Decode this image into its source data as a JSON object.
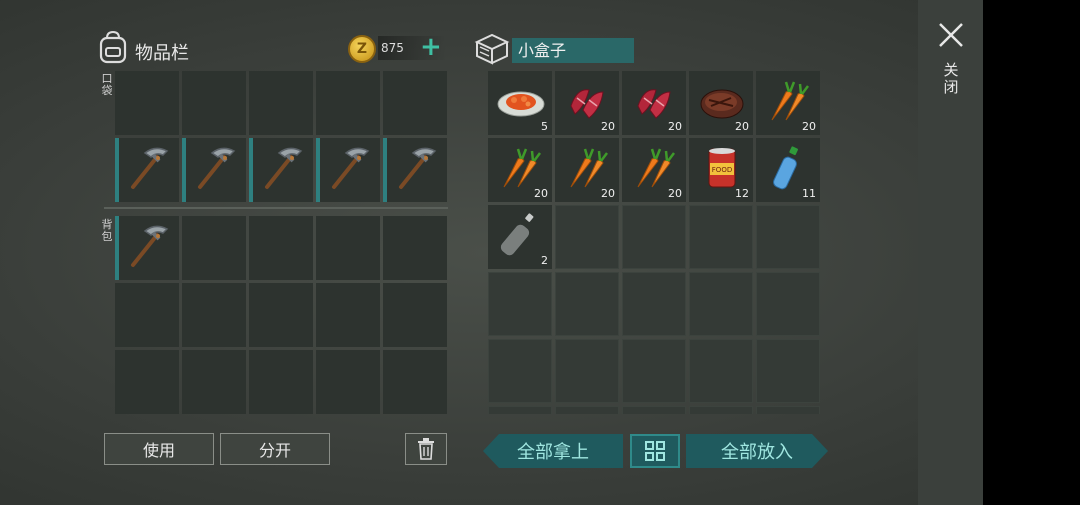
{
  "inventory": {
    "title": "物品栏",
    "coins": "875",
    "plus": "+",
    "pocket_label": "口袋",
    "backpack_label": "背包",
    "use_button": "使用",
    "split_button": "分开"
  },
  "pocket_slots": [
    {
      "item": "",
      "count": ""
    },
    {
      "item": "",
      "count": ""
    },
    {
      "item": "",
      "count": ""
    },
    {
      "item": "",
      "count": ""
    },
    {
      "item": "",
      "count": ""
    },
    {
      "item": "pickaxe",
      "count": ""
    },
    {
      "item": "pickaxe",
      "count": ""
    },
    {
      "item": "pickaxe",
      "count": ""
    },
    {
      "item": "pickaxe",
      "count": ""
    },
    {
      "item": "pickaxe",
      "count": ""
    }
  ],
  "backpack_slots": [
    {
      "item": "pickaxe",
      "count": ""
    },
    {
      "item": "",
      "count": ""
    },
    {
      "item": "",
      "count": ""
    },
    {
      "item": "",
      "count": ""
    },
    {
      "item": "",
      "count": ""
    },
    {
      "item": "",
      "count": ""
    },
    {
      "item": "",
      "count": ""
    },
    {
      "item": "",
      "count": ""
    },
    {
      "item": "",
      "count": ""
    },
    {
      "item": "",
      "count": ""
    },
    {
      "item": "",
      "count": ""
    },
    {
      "item": "",
      "count": ""
    },
    {
      "item": "",
      "count": ""
    },
    {
      "item": "",
      "count": ""
    },
    {
      "item": "",
      "count": ""
    }
  ],
  "box": {
    "name": "小盒子",
    "take_all": "全部拿上",
    "put_all": "全部放入",
    "slots": [
      {
        "item": "salad-plate",
        "count": "5"
      },
      {
        "item": "raw-meat",
        "count": "20"
      },
      {
        "item": "raw-meat",
        "count": "20"
      },
      {
        "item": "steak",
        "count": "20"
      },
      {
        "item": "carrot",
        "count": "20"
      },
      {
        "item": "carrot",
        "count": "20"
      },
      {
        "item": "carrot",
        "count": "20"
      },
      {
        "item": "carrot",
        "count": "20"
      },
      {
        "item": "canned-food",
        "count": "12"
      },
      {
        "item": "water-bottle",
        "count": "11"
      },
      {
        "item": "empty-bottle",
        "count": "2"
      },
      {
        "item": "",
        "count": ""
      },
      {
        "item": "",
        "count": ""
      },
      {
        "item": "",
        "count": ""
      },
      {
        "item": "",
        "count": ""
      },
      {
        "item": "",
        "count": ""
      },
      {
        "item": "",
        "count": ""
      },
      {
        "item": "",
        "count": ""
      },
      {
        "item": "",
        "count": ""
      },
      {
        "item": "",
        "count": ""
      },
      {
        "item": "",
        "count": ""
      },
      {
        "item": "",
        "count": ""
      },
      {
        "item": "",
        "count": ""
      },
      {
        "item": "",
        "count": ""
      },
      {
        "item": "",
        "count": ""
      },
      {
        "item": "",
        "count": ""
      },
      {
        "item": "",
        "count": ""
      },
      {
        "item": "",
        "count": ""
      },
      {
        "item": "",
        "count": ""
      },
      {
        "item": "",
        "count": ""
      }
    ]
  },
  "close_label": "关闭",
  "colors": {
    "accent": "#2a6868",
    "stripe": "#2e8080",
    "coin": "#e0b030"
  }
}
